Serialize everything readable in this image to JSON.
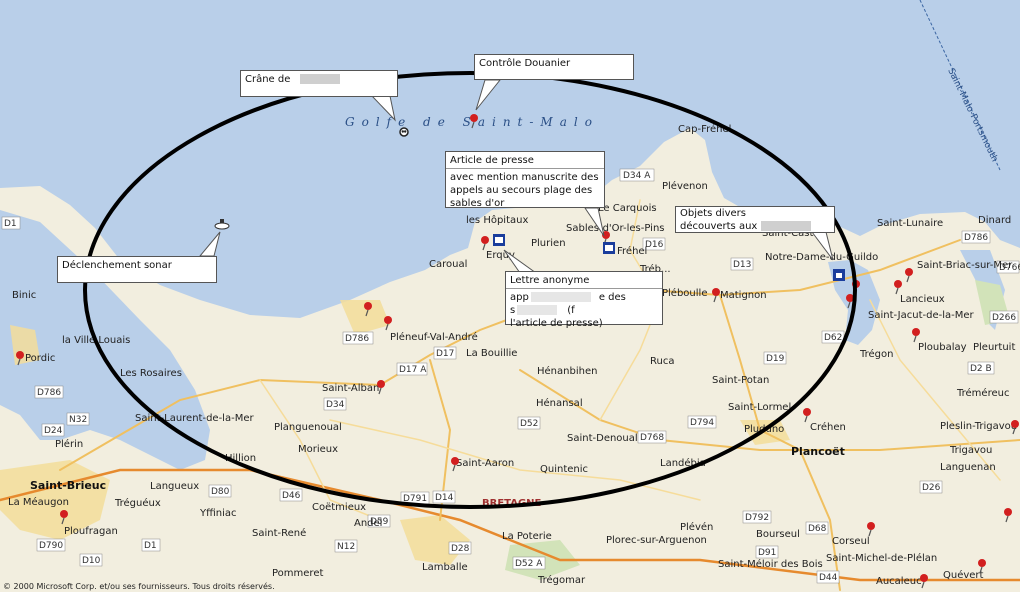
{
  "map": {
    "sea_label": "Golfe de Saint-Malo",
    "ferry_route": "Saint-Malo-Portsmouth",
    "region_label": "BRETAGNE",
    "copyright": "© 2000 Microsoft Corp. et/ou ses fournisseurs. Tous droits réservés.",
    "places": [
      "Cap-Fréhel",
      "Plévenon",
      "Le Carquois",
      "Sables-d'Or-les-Pins",
      "Fréhel",
      "les Hôpitaux",
      "Erquy",
      "Plurien",
      "Caroual",
      "Saint-Lunaire",
      "Dinard",
      "Saint-Briac-sur-Mer",
      "Lancieux",
      "Saint-Jacut-de-la-Mer",
      "Ploubalay",
      "Pleurtuit",
      "Notre-Dame-du-Guildo",
      "Matignon",
      "Tréméreuc",
      "Pleslin-Trigavou",
      "Trigavou",
      "Languenan",
      "Binic",
      "Pordic",
      "la Ville Louais",
      "Les Rosaires",
      "Saint-Brieuc",
      "Plérin",
      "Saint-Laurent-de-la-Mer",
      "Pléneuf-Val-André",
      "La Bouillie",
      "Hénanbihen",
      "Hénansal",
      "Saint-Alban",
      "Planguenoual",
      "Morieux",
      "Ruca",
      "Saint-Potan",
      "Saint-Lormel",
      "Créhen",
      "Plancoët",
      "Pluduno",
      "Tréguéux",
      "Langueux",
      "Yffiniac",
      "Saint-Denoual",
      "Saint-Aaron",
      "Quintenic",
      "Landébia",
      "Coëtmieux",
      "Andel",
      "Saint-René",
      "Ploufragan",
      "La Méaugon",
      "Pommeret",
      "Lamballe",
      "La Poterie",
      "Trégomar",
      "Plévén",
      "Plorec-sur-Arguenon",
      "Bourseul",
      "Saint-Méloir des Bois",
      "Corseul",
      "Saint-Michel-de-Plélan",
      "Aucaleuc",
      "Quévert",
      "Hillion",
      "Saint-Cast",
      "Pléboulle",
      "Tréb...",
      "Trégon"
    ],
    "roads": [
      "D34 A",
      "D16",
      "D786",
      "D13",
      "D62",
      "D19",
      "D794",
      "D768",
      "D17",
      "D17 A",
      "D52",
      "D14",
      "D791",
      "D80",
      "D46",
      "D59",
      "D28",
      "N12",
      "D1",
      "D10",
      "D790",
      "D24",
      "N32",
      "D786",
      "D34",
      "D786",
      "D26",
      "D2 B",
      "D766",
      "D266",
      "D68",
      "D91",
      "D44",
      "D792",
      "D52 A",
      "D1"
    ]
  },
  "callouts": [
    {
      "id": "crane",
      "text": "Crâne de"
    },
    {
      "id": "controle",
      "text": "Contrôle Douanier"
    },
    {
      "id": "article",
      "title": "Article de presse",
      "lines": [
        "avec mention manuscrite des",
        "appels au secours plage des",
        "sables d'or"
      ]
    },
    {
      "id": "objets",
      "lines": [
        "Objets divers",
        "découverts aux"
      ]
    },
    {
      "id": "sonar",
      "text": "Déclenchement sonar"
    },
    {
      "id": "lettre",
      "title": "Lettre anonyme",
      "lines": [
        "app",
        "s",
        "l'article de presse)"
      ],
      "fragments": [
        "e des",
        "(f"
      ]
    }
  ]
}
